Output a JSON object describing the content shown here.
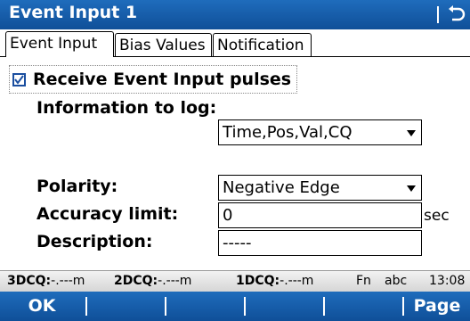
{
  "window": {
    "title": "Event Input 1",
    "back_icon": "back-arrow-icon"
  },
  "tabs": [
    {
      "label": "Event Input",
      "active": true
    },
    {
      "label": "Bias Values",
      "active": false
    },
    {
      "label": "Notification",
      "active": false
    }
  ],
  "form": {
    "receive_checkbox": {
      "label": "Receive Event Input pulses",
      "checked": true
    },
    "info_to_log": {
      "label": "Information to log:",
      "value": "Time,Pos,Val,CQ"
    },
    "polarity": {
      "label": "Polarity:",
      "value": "Negative Edge"
    },
    "accuracy_limit": {
      "label": "Accuracy limit:",
      "value": "0",
      "unit": "sec"
    },
    "description": {
      "label": "Description:",
      "value": "-----"
    }
  },
  "status_bar": {
    "dcq3_label": "3DCQ:",
    "dcq3_value": "-.---m",
    "dcq2_label": "2DCQ:",
    "dcq2_value": "-.---m",
    "dcq1_label": "1DCQ:",
    "dcq1_value": "-.---m",
    "fn": "Fn",
    "input_mode": "abc",
    "time": "13:08"
  },
  "softkeys": {
    "left": "OK",
    "right": "Page"
  },
  "colors": {
    "title_blue": "#1560b0",
    "checkbox_blue": "#1b4fa0"
  }
}
